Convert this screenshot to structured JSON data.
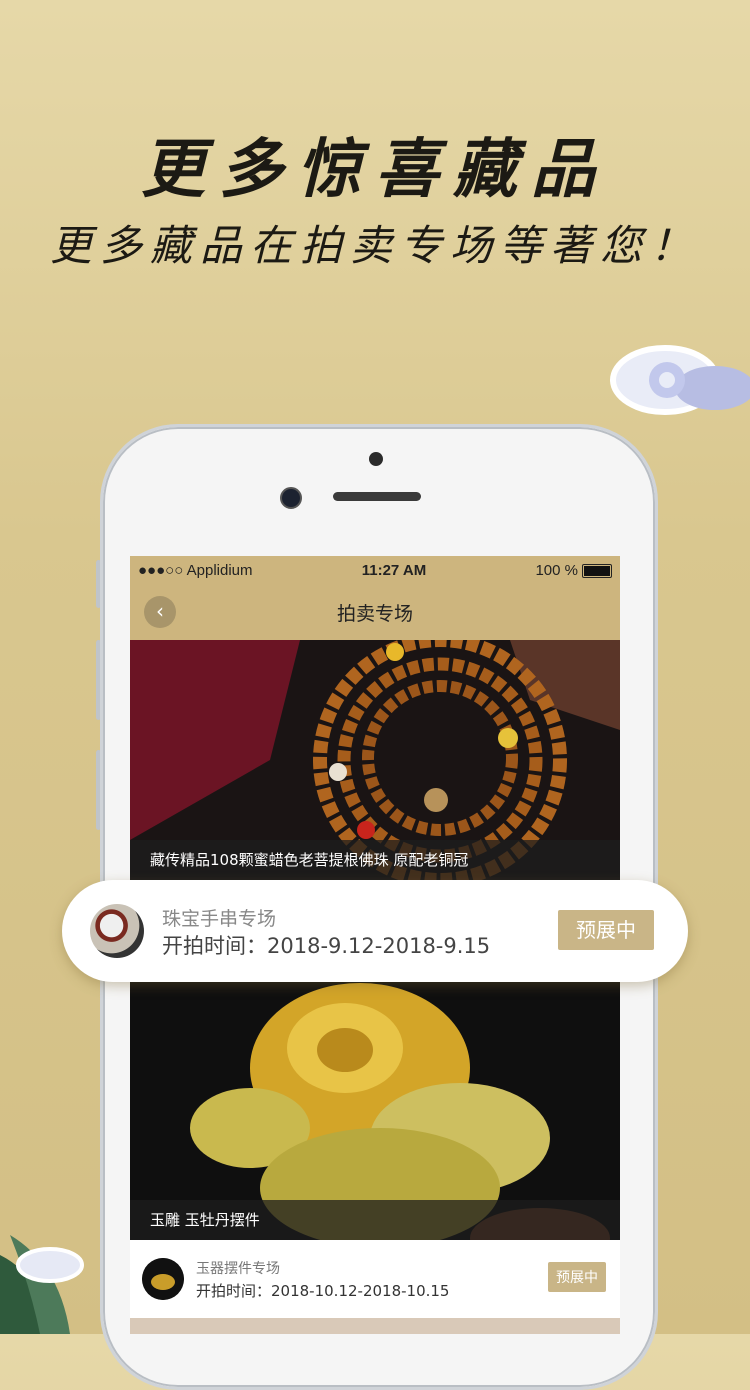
{
  "headline": "更多惊喜藏品",
  "subheadline": "更多藏品在拍卖专场等著您！",
  "status": {
    "carrier": "●●●○○ Applidium",
    "time": "11:27 AM",
    "battery": "100 %"
  },
  "nav": {
    "title": "拍卖专场",
    "back_icon": "‹"
  },
  "items": [
    {
      "caption": "藏传精品108颗蜜蜡色老菩提根佛珠 原配老铜冠",
      "name": "珠宝手串专场",
      "time": "开拍时间：2018-9.12-2018-9.15",
      "badge": "预展中"
    },
    {
      "caption": "玉雕 玉牡丹摆件",
      "name": "玉器摆件专场",
      "time": "开拍时间：2018-10.12-2018-10.15",
      "badge": "预展中"
    }
  ]
}
